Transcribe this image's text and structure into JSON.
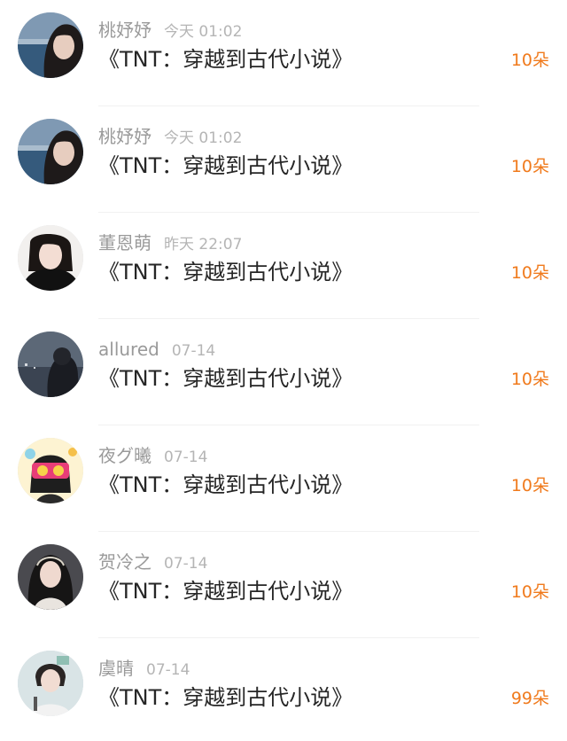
{
  "feed": {
    "items": [
      {
        "username": "桃妤妤",
        "time": "今天 01:02",
        "title": "《TNT：穿越到古代小说》",
        "gift": "10朵"
      },
      {
        "username": "桃妤妤",
        "time": "今天 01:02",
        "title": "《TNT：穿越到古代小说》",
        "gift": "10朵"
      },
      {
        "username": "董恩萌",
        "time": "昨天 22:07",
        "title": "《TNT：穿越到古代小说》",
        "gift": "10朵"
      },
      {
        "username": "allured",
        "time": "07-14",
        "title": "《TNT：穿越到古代小说》",
        "gift": "10朵"
      },
      {
        "username": "夜グ曦",
        "time": "07-14",
        "title": "《TNT：穿越到古代小说》",
        "gift": "10朵"
      },
      {
        "username": "贺冷之",
        "time": "07-14",
        "title": "《TNT：穿越到古代小说》",
        "gift": "10朵"
      },
      {
        "username": "虞晴",
        "time": "07-14",
        "title": "《TNT：穿越到古代小说》",
        "gift": "99朵"
      }
    ]
  },
  "colors": {
    "gift_accent": "#f07a1c",
    "username": "#9a9a9a",
    "time": "#b5b5b5",
    "title": "#262626"
  }
}
